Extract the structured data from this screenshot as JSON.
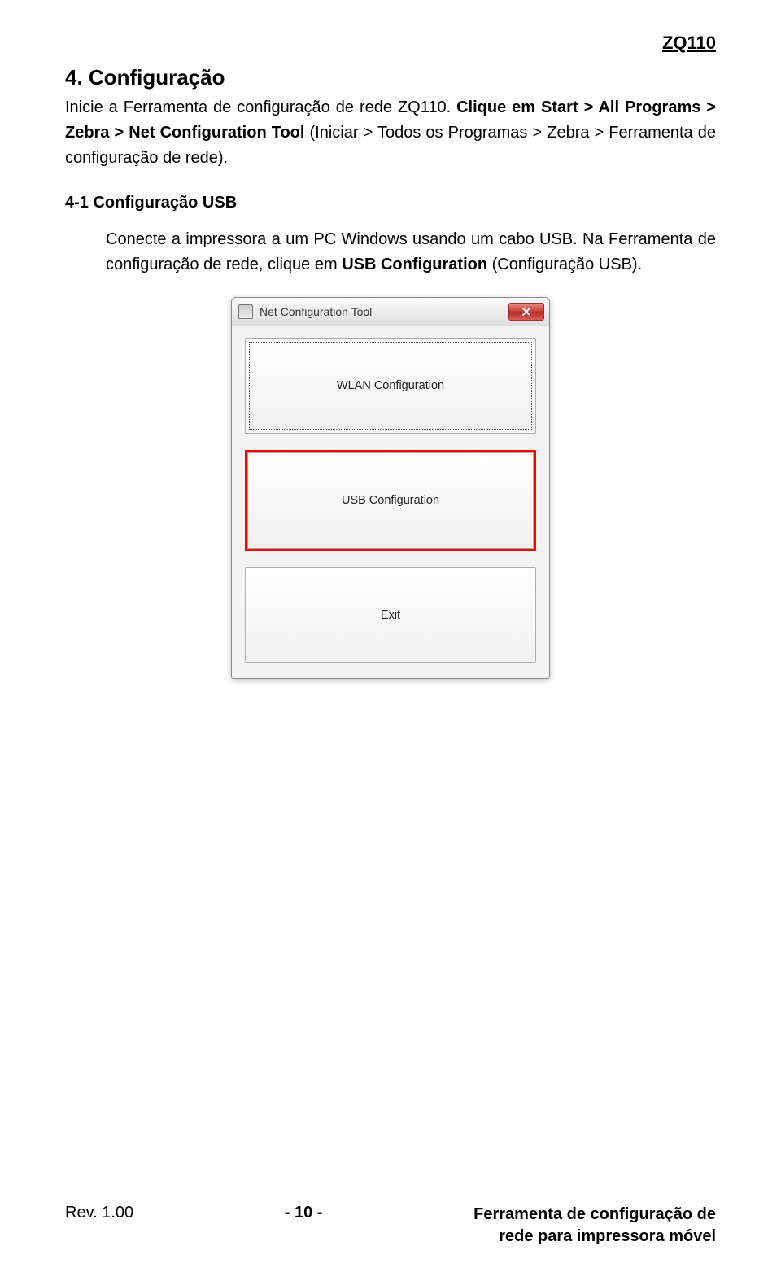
{
  "header": {
    "doc_code": "ZQ110"
  },
  "section": {
    "title": "4. Configuração",
    "intro_plain": "Inicie a Ferramenta de configuração de rede ZQ110. ",
    "intro_bold1": "Clique em Start > All Programs > Zebra > Net Configuration Tool ",
    "intro_plain2": "(Iniciar > Todos os Programas > Zebra > Ferramenta de configuração de rede)."
  },
  "subsection": {
    "title": "4-1 Configuração USB",
    "para_a": "Conecte a impressora a um PC Windows usando um cabo USB. Na Ferramenta de configuração de rede, clique em ",
    "para_bold": "USB Configuration",
    "para_b": " (Configuração USB)."
  },
  "dialog": {
    "title": "Net Configuration Tool",
    "buttons": {
      "wlan": "WLAN Configuration",
      "usb": "USB Configuration",
      "exit": "Exit"
    }
  },
  "footer": {
    "rev": "Rev. 1.00",
    "page": "- 10 -",
    "product_line1": "Ferramenta de configuração de",
    "product_line2": "rede para impressora móvel"
  }
}
